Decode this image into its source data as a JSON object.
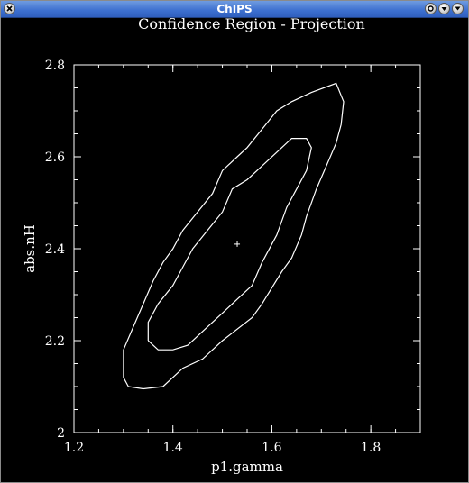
{
  "window": {
    "title": "ChIPS",
    "buttons": [
      "close",
      "iconify",
      "maximize",
      "menu"
    ]
  },
  "chart_data": {
    "type": "contour",
    "title": "Confidence Region - Projection",
    "xlabel": "p1.gamma",
    "ylabel": "abs.nH",
    "xlim": [
      1.2,
      1.9
    ],
    "ylim": [
      2.0,
      2.8
    ],
    "xticks": [
      1.2,
      1.4,
      1.6,
      1.8
    ],
    "yticks": [
      2,
      2.2,
      2.4,
      2.6,
      2.8
    ],
    "xtick_labels": [
      "1.2",
      "1.4",
      "1.6",
      "1.8"
    ],
    "ytick_labels": [
      "2",
      "2.2",
      "2.4",
      "2.6",
      "2.8"
    ],
    "best_fit": {
      "x": 1.53,
      "y": 2.41
    },
    "colors": {
      "background": "#000000",
      "foreground": "#ffffff"
    },
    "contours": [
      {
        "name": "outer",
        "points": [
          [
            1.3,
            2.15
          ],
          [
            1.3,
            2.12
          ],
          [
            1.31,
            2.1
          ],
          [
            1.34,
            2.095
          ],
          [
            1.38,
            2.1
          ],
          [
            1.42,
            2.14
          ],
          [
            1.46,
            2.16
          ],
          [
            1.5,
            2.2
          ],
          [
            1.56,
            2.25
          ],
          [
            1.58,
            2.28
          ],
          [
            1.62,
            2.35
          ],
          [
            1.64,
            2.38
          ],
          [
            1.66,
            2.43
          ],
          [
            1.67,
            2.47
          ],
          [
            1.69,
            2.53
          ],
          [
            1.71,
            2.58
          ],
          [
            1.73,
            2.63
          ],
          [
            1.74,
            2.67
          ],
          [
            1.745,
            2.72
          ],
          [
            1.73,
            2.76
          ],
          [
            1.68,
            2.74
          ],
          [
            1.64,
            2.72
          ],
          [
            1.61,
            2.7
          ],
          [
            1.58,
            2.66
          ],
          [
            1.55,
            2.62
          ],
          [
            1.53,
            2.6
          ],
          [
            1.5,
            2.57
          ],
          [
            1.48,
            2.52
          ],
          [
            1.45,
            2.48
          ],
          [
            1.42,
            2.44
          ],
          [
            1.4,
            2.4
          ],
          [
            1.38,
            2.37
          ],
          [
            1.36,
            2.33
          ],
          [
            1.34,
            2.28
          ],
          [
            1.32,
            2.23
          ],
          [
            1.3,
            2.18
          ],
          [
            1.3,
            2.15
          ]
        ]
      },
      {
        "name": "inner",
        "points": [
          [
            1.35,
            2.2
          ],
          [
            1.37,
            2.18
          ],
          [
            1.4,
            2.18
          ],
          [
            1.43,
            2.19
          ],
          [
            1.46,
            2.22
          ],
          [
            1.5,
            2.26
          ],
          [
            1.53,
            2.29
          ],
          [
            1.56,
            2.32
          ],
          [
            1.58,
            2.37
          ],
          [
            1.61,
            2.43
          ],
          [
            1.63,
            2.49
          ],
          [
            1.65,
            2.53
          ],
          [
            1.67,
            2.57
          ],
          [
            1.68,
            2.62
          ],
          [
            1.67,
            2.64
          ],
          [
            1.64,
            2.64
          ],
          [
            1.61,
            2.61
          ],
          [
            1.58,
            2.58
          ],
          [
            1.55,
            2.55
          ],
          [
            1.52,
            2.53
          ],
          [
            1.5,
            2.48
          ],
          [
            1.47,
            2.44
          ],
          [
            1.44,
            2.4
          ],
          [
            1.42,
            2.36
          ],
          [
            1.4,
            2.32
          ],
          [
            1.37,
            2.28
          ],
          [
            1.35,
            2.24
          ],
          [
            1.35,
            2.2
          ]
        ]
      }
    ]
  }
}
